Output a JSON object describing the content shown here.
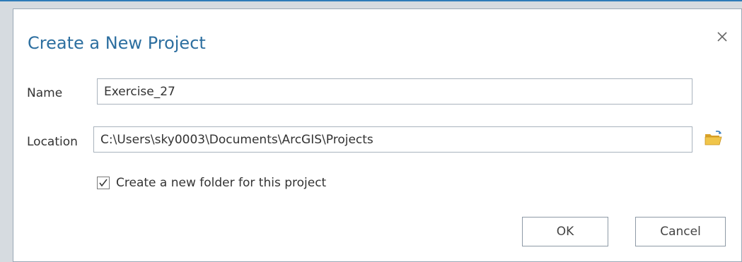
{
  "dialog": {
    "title": "Create a New Project",
    "close_icon": "close-icon"
  },
  "form": {
    "name_label": "Name",
    "name_value": "Exercise_27",
    "location_label": "Location",
    "location_value": "C:\\Users\\sky0003\\Documents\\ArcGIS\\Projects",
    "browse_icon": "folder-open-icon",
    "create_folder_label": "Create a new folder for this project",
    "create_folder_checked": true
  },
  "buttons": {
    "ok_label": "OK",
    "cancel_label": "Cancel"
  },
  "colors": {
    "title": "#2d6fa0",
    "accent_line": "#2e7bb8",
    "folder": "#e8b73a"
  }
}
